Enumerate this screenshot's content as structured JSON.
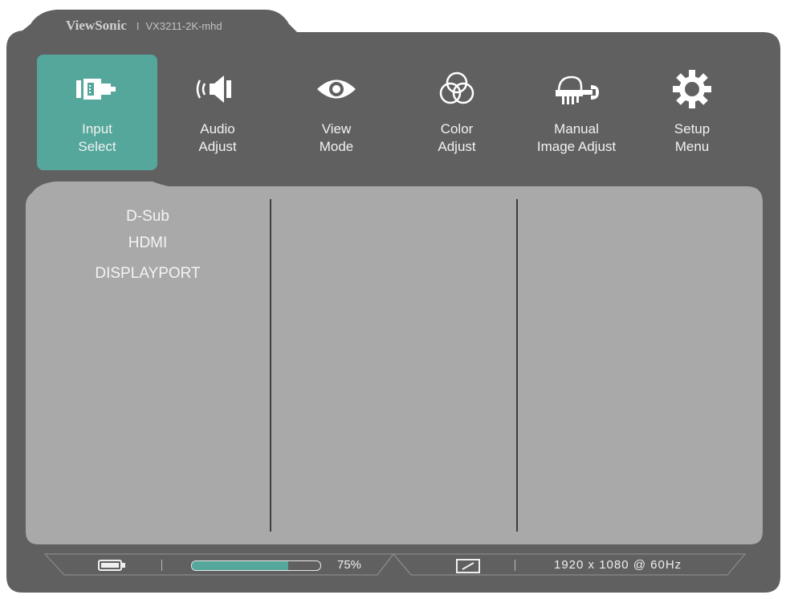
{
  "brand": {
    "name": "ViewSonic",
    "separator": "I",
    "model": "VX3211-2K-mhd"
  },
  "menu": [
    {
      "label_line1": "Input",
      "label_line2": "Select",
      "icon": "input-select-icon",
      "active": true
    },
    {
      "label_line1": "Audio",
      "label_line2": "Adjust",
      "icon": "speaker-icon",
      "active": false
    },
    {
      "label_line1": "View",
      "label_line2": "Mode",
      "icon": "eye-icon",
      "active": false
    },
    {
      "label_line1": "Color",
      "label_line2": "Adjust",
      "icon": "color-circles-icon",
      "active": false
    },
    {
      "label_line1": "Manual",
      "label_line2": "Image Adjust",
      "icon": "hand-wrench-icon",
      "active": false
    },
    {
      "label_line1": "Setup",
      "label_line2": "Menu",
      "icon": "gear-icon",
      "active": false
    }
  ],
  "input_options": [
    "D-Sub",
    "HDMI",
    "DISPLAYPORT"
  ],
  "status": {
    "battery_icon": "battery-icon",
    "progress_percent": 75,
    "progress_label": "75%",
    "aspect_icon": "aspect-ratio-icon",
    "resolution": "1920 x 1080 @ 60Hz"
  },
  "colors": {
    "osd_frame": "#606060",
    "osd_panel": "#a9a9a9",
    "accent": "#55a79c"
  }
}
